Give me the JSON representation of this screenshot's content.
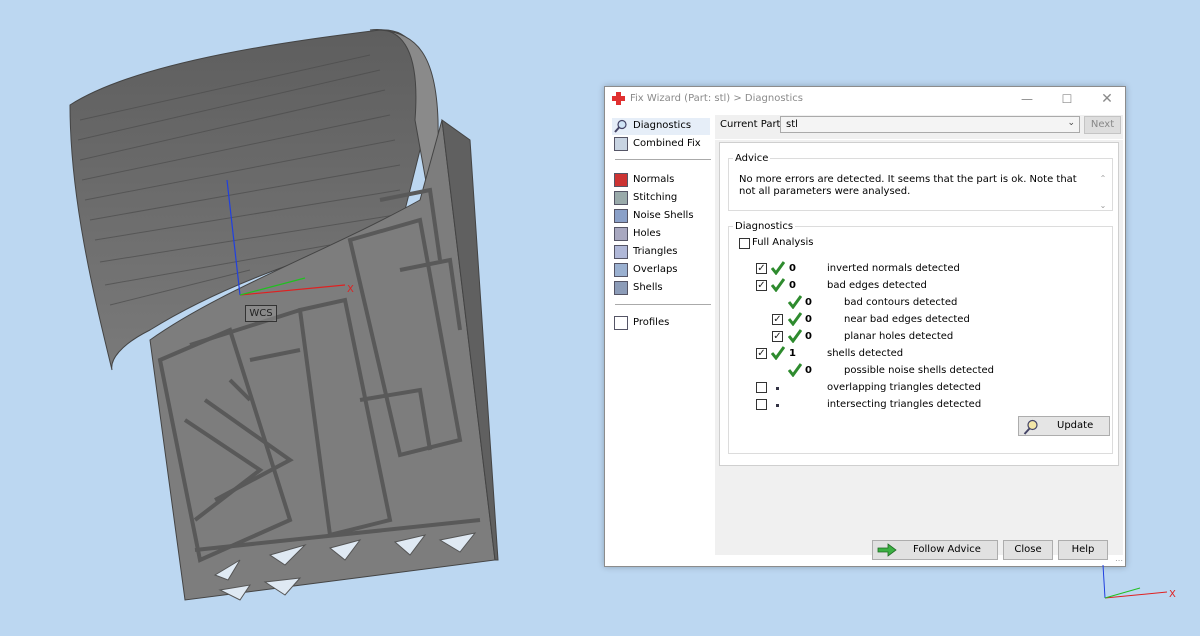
{
  "viewport": {
    "wcs_label": "WCS",
    "axis_x_label": "X"
  },
  "dialog": {
    "title": "Fix Wizard (Part: stl) > Diagnostics",
    "window_buttons": {
      "minimize": "—",
      "maximize": "☐",
      "close": "✕"
    }
  },
  "nav": {
    "items": [
      {
        "label": "Diagnostics"
      },
      {
        "label": "Combined Fix"
      },
      {
        "label": "Normals"
      },
      {
        "label": "Stitching"
      },
      {
        "label": "Noise Shells"
      },
      {
        "label": "Holes"
      },
      {
        "label": "Triangles"
      },
      {
        "label": "Overlaps"
      },
      {
        "label": "Shells"
      },
      {
        "label": "Profiles"
      }
    ]
  },
  "panel": {
    "current_part_label": "Current Part:",
    "current_part_value": "stl",
    "next_label": "Next",
    "advice": {
      "legend": "Advice",
      "text": "No more errors are detected. It seems that the part is ok. Note that not all parameters were analysed."
    },
    "diagnostics": {
      "legend": "Diagnostics",
      "full_analysis_label": "Full Analysis",
      "rows": [
        {
          "count": "0",
          "label": "inverted normals detected"
        },
        {
          "count": "0",
          "label": "bad edges detected"
        },
        {
          "count": "0",
          "label": "bad contours detected"
        },
        {
          "count": "0",
          "label": "near bad edges detected"
        },
        {
          "count": "0",
          "label": "planar holes detected"
        },
        {
          "count": "1",
          "label": "shells detected"
        },
        {
          "count": "0",
          "label": "possible noise shells detected"
        },
        {
          "count": "",
          "label": "overlapping triangles detected"
        },
        {
          "count": "",
          "label": "intersecting triangles detected"
        }
      ],
      "update_label": "Update"
    }
  },
  "buttons": {
    "follow_advice": "Follow Advice",
    "close": "Close",
    "help": "Help"
  },
  "colors": {
    "background": "#bcd7f1",
    "check_green": "#2e8b2e",
    "app_icon_red": "#e03030"
  }
}
